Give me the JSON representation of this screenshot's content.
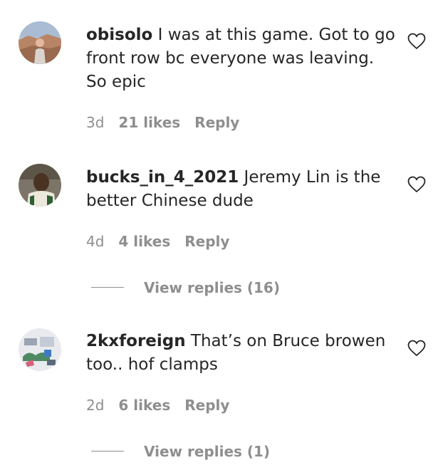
{
  "comments": [
    {
      "username": "obisolo",
      "text": " I was at this game. Got to go front row bc everyone was leaving. So epic",
      "time": "3d",
      "likes": "21 likes",
      "reply": "Reply"
    },
    {
      "username": "bucks_in_4_2021",
      "text": " Jeremy Lin is the better Chinese dude",
      "time": "4d",
      "likes": "4 likes",
      "reply": "Reply",
      "view_replies": "View replies (16)"
    },
    {
      "username": "2kxforeign",
      "text": " That’s on Bruce browen too.. hof clamps",
      "time": "2d",
      "likes": "6 likes",
      "reply": "Reply",
      "view_replies": "View replies (1)"
    }
  ],
  "icons": {
    "like": "heart-outline-icon"
  },
  "colors": {
    "text": "#262626",
    "muted": "#8e8e8e"
  }
}
